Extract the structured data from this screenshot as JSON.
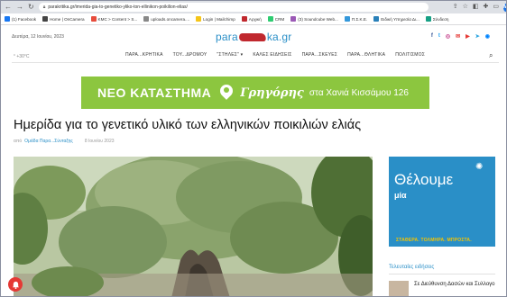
{
  "browser": {
    "url": "parakritika.gr/imerida-gia-to-genetiko-yliko-ton-ellinikon-poikilion-elias/",
    "avatar_letter": "M",
    "bookmarks": [
      {
        "label": "(1) Facebook",
        "color": "#1877f2"
      },
      {
        "label": "Home | OnCamera",
        "color": "#444"
      },
      {
        "label": "KMC > Content > S...",
        "color": "#e74c3c"
      },
      {
        "label": "uploads.oncamera....",
        "color": "#888"
      },
      {
        "label": "Login | Mailchimp",
        "color": "#f5c518"
      },
      {
        "label": "Αρχική",
        "color": "#c0282e"
      },
      {
        "label": "CRM",
        "color": "#2ecc71"
      },
      {
        "label": "(3) Soundcube Web...",
        "color": "#9b59b6"
      },
      {
        "label": "Π.Σ.Κ.Ε.",
        "color": "#3498db"
      },
      {
        "label": "Ειδική Υπηρεσία Δι...",
        "color": "#2980b9"
      },
      {
        "label": "Σύνδεση",
        "color": "#16a085"
      }
    ]
  },
  "site": {
    "date": "Δευτέρα, 12 Ιουνίου, 2023",
    "logo_left": "para",
    "logo_right": "ka.gr",
    "social": [
      {
        "icon": "facebook-icon",
        "glyph": "f",
        "color": "#3b5998"
      },
      {
        "icon": "twitter-icon",
        "glyph": "t",
        "color": "#1da1f2"
      },
      {
        "icon": "instagram-icon",
        "glyph": "◎",
        "color": "#c13584"
      },
      {
        "icon": "email-icon",
        "glyph": "✉",
        "color": "#e53935"
      },
      {
        "icon": "youtube-icon",
        "glyph": "▶",
        "color": "#e53935"
      },
      {
        "icon": "telegram-icon",
        "glyph": "➤",
        "color": "#2ca5e0"
      },
      {
        "icon": "messenger-icon",
        "glyph": "◉",
        "color": "#0084ff"
      }
    ],
    "weather": "° +30°C",
    "nav": [
      "ΠΑΡΑ...ΚΡΗΤΙΚΑ",
      "ΤΟΥ...ΔΡΟΜΟΥ",
      "\"ΣΤΗΛΕΣ\" ▾",
      "ΚΑΛΕΣ ΕΙΔΗΣΕΙΣ",
      "ΠΑΡΑ...ΣΚΕΥΕΣ",
      "ΠΑΡΑ...ΘΛΗΤΙΚΑ",
      "ΠΟΛΙΤΙΣΜΟΣ"
    ]
  },
  "banner": {
    "text1": "ΝΕΟ ΚΑΤΑΣΤΗΜΑ",
    "text2": "Γρηγόρης",
    "text3": "στα Χανιά Κισσάμου 126"
  },
  "article": {
    "title": "Ημερίδα για το γενετικό υλικό των ελληνικών ποικιλιών ελιάς",
    "by": "από",
    "author": "Ομάδα Παρα...Σύνταξης",
    "date": "8 Ιουνίου 2023"
  },
  "sidebar": {
    "ad_line1": "Θέλουμε",
    "ad_line2": "μία",
    "ad_slogan": "ΣΤΑΘΕΡΑ. ΤΟΛΜΗΡΑ. ΜΠΡΟΣΤΑ.",
    "latest_heading": "Τελευταίες ειδήσεις",
    "latest_item": "Σε Διεύθυνση Δασών και Συλλογο"
  },
  "colors": {
    "brand_blue": "#2a8fc7",
    "banner_green": "#8cc63f",
    "logo_red": "#c0282e"
  }
}
